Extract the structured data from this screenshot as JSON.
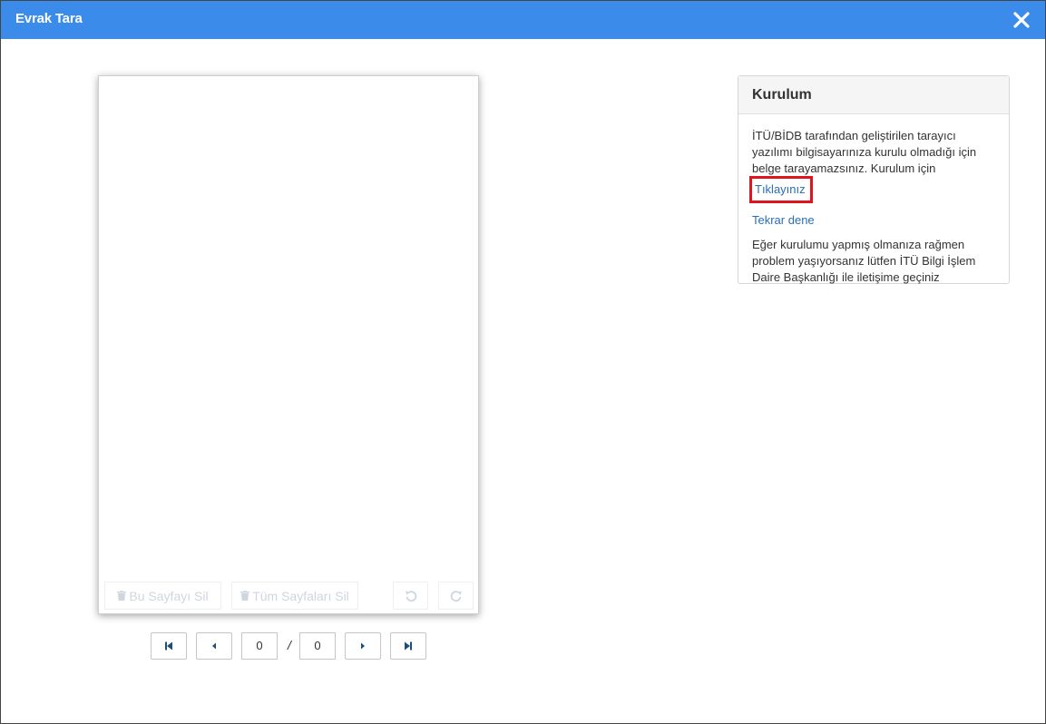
{
  "modal": {
    "title": "Evrak Tara",
    "close_icon": "close-icon"
  },
  "preview": {
    "toolbar": {
      "delete_page_label": "Bu Sayfayı Sil",
      "delete_all_label": "Tüm Sayfaları Sil",
      "undo_icon": "rotate-left-icon",
      "redo_icon": "rotate-right-icon"
    }
  },
  "pager": {
    "current_page": "0",
    "separator": "/",
    "total_pages": "0",
    "first_icon": "step-backward-icon",
    "prev_icon": "triangle-left-icon",
    "next_icon": "triangle-right-icon",
    "last_icon": "step-forward-icon"
  },
  "panel": {
    "title": "Kurulum",
    "message": "İTÜ/BİDB tarafından geliştirilen tarayıcı yazılımı bilgisayarınıza kurulu olmadığı için belge tarayamazsınız. Kurulum için",
    "install_link": "Tıklayınız",
    "retry_link": "Tekrar dene",
    "help_text": "Eğer kurulumu yapmış olmanıza rağmen problem yaşıyorsanız lütfen İTÜ Bilgi İşlem Daire Başkanlığı ile iletişime geçiniz"
  },
  "colors": {
    "header": "#3b8beb",
    "link": "#2a6db5",
    "highlight_border": "#e0141e",
    "pager_icon": "#1f4e79"
  }
}
